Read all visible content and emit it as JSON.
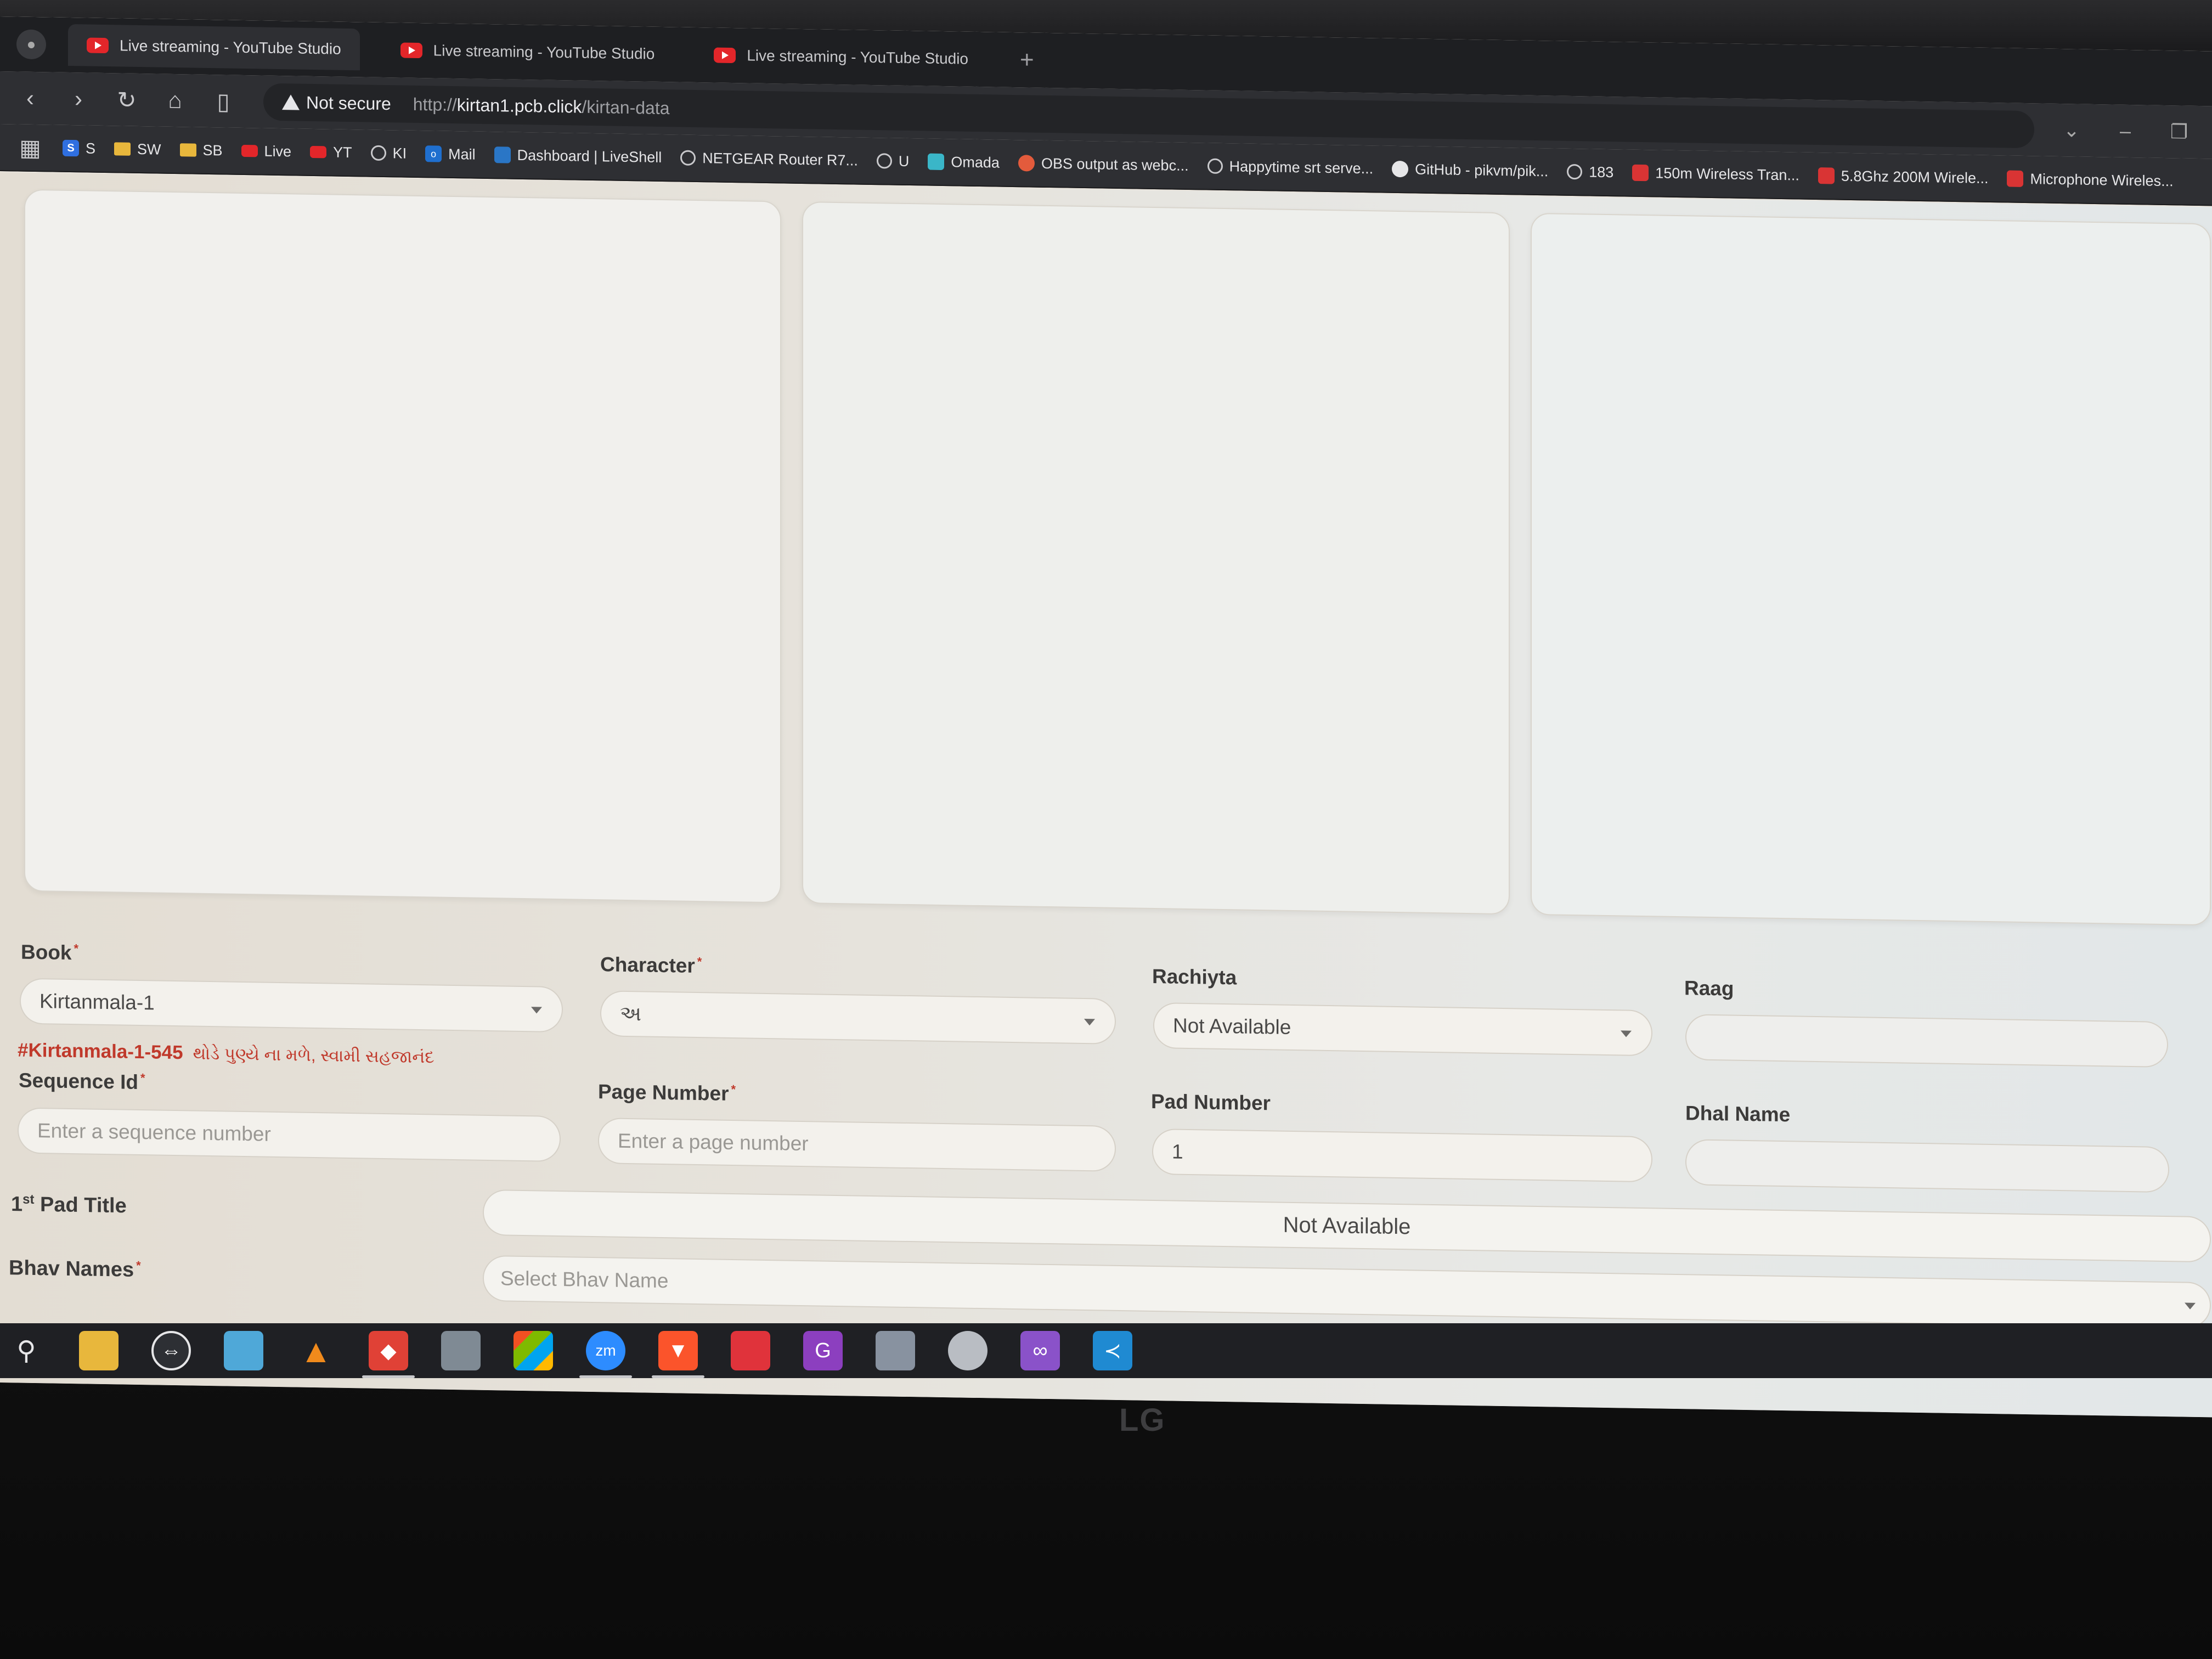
{
  "browser": {
    "tabs": [
      {
        "title": "Live streaming - YouTube Studio",
        "active": true
      },
      {
        "title": "Live streaming - YouTube Studio",
        "active": false
      },
      {
        "title": "Live streaming - YouTube Studio",
        "active": false
      }
    ],
    "new_tab_symbol": "+",
    "security_label": "Not secure",
    "url_prefix": "http://",
    "url_host": "kirtan1.pcb.click",
    "url_path": "/kirtan-data",
    "bookmarks": [
      "S",
      "SW",
      "SB",
      "Live",
      "YT",
      "KI",
      "Mail",
      "Dashboard | LiveShell",
      "NETGEAR Router R7...",
      "U",
      "Omada",
      "OBS output as webc...",
      "Happytime srt serve...",
      "GitHub - pikvm/pik...",
      "183",
      "150m Wireless Tran...",
      "5.8Ghz 200M Wirele...",
      "Microphone Wireles..."
    ]
  },
  "form": {
    "book": {
      "label": "Book",
      "value": "Kirtanmala-1"
    },
    "character": {
      "label": "Character",
      "value": "અ"
    },
    "rachiyta": {
      "label": "Rachiyta",
      "value": "Not Available"
    },
    "raag": {
      "label": "Raag",
      "value": ""
    },
    "kirtan_ref": {
      "id": "#Kirtanmala-1-545",
      "text": "થોડે પુણ્યે ના મળે, સ્વામી સહજાનંદ"
    },
    "sequence_id": {
      "label": "Sequence Id",
      "placeholder": "Enter a sequence number"
    },
    "page_number": {
      "label": "Page Number",
      "placeholder": "Enter a page number"
    },
    "pad_number": {
      "label": "Pad Number",
      "value": "1"
    },
    "dhal_name": {
      "label": "Dhal Name",
      "value": ""
    },
    "first_pad_title": {
      "label_num": "1",
      "label_sup": "st",
      "label_rest": "Pad Title",
      "value": "Not Available"
    },
    "bhav_names": {
      "label": "Bhav Names",
      "placeholder": "Select Bhav Name"
    },
    "required_mark": "*"
  },
  "taskbar": {
    "icons": [
      "search-icon",
      "file-explorer-icon",
      "teamviewer-icon",
      "notepad-icon",
      "vlc-icon",
      "anydesk-icon",
      "remote-desktop-icon",
      "microsoft-store-icon",
      "zoom-icon",
      "brave-icon",
      "pdf-icon",
      "pdf-gear-icon",
      "network-icon",
      "vpn-icon",
      "visual-studio-icon",
      "vscode-icon"
    ],
    "zoom_label": "zm"
  },
  "monitor_brand": "LG",
  "colors": {
    "accent_red": "#c0392b",
    "youtube_red": "#e3262a",
    "vscode_blue": "#1f8ad2",
    "visual_studio_purple": "#8a52c9"
  }
}
